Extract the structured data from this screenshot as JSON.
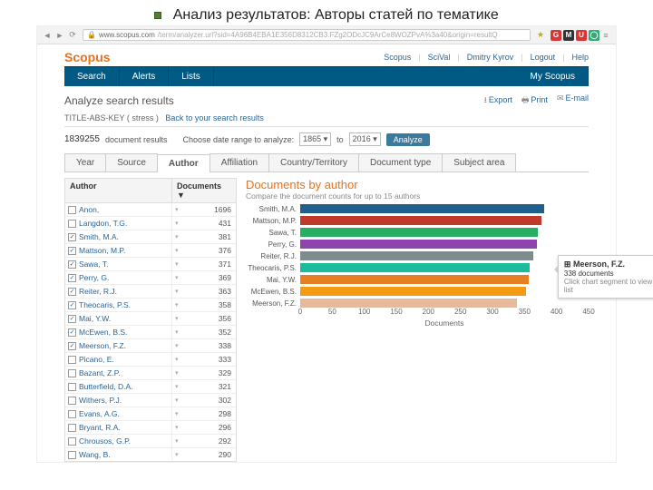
{
  "slide": {
    "title": "Анализ результатов: Авторы статей по тематике"
  },
  "browser": {
    "url_host": "www.scopus.com",
    "url_path": "/term/analyzer.url?sid=4A96B4EBA1E356D8312CB3.FZg2ODcJC9ArCe8WOZPvA%3a40&origin=resultQ"
  },
  "brand": "Scopus",
  "top_links": [
    "Scopus",
    "SciVal",
    "Dmitry Kyrov",
    "Logout",
    "Help"
  ],
  "nav": {
    "items": [
      "Search",
      "Alerts",
      "Lists"
    ],
    "right": "My Scopus"
  },
  "header": {
    "title": "Analyze search results",
    "actions": [
      {
        "icon": "⭳",
        "label": "Export"
      },
      {
        "icon": "🖶",
        "label": "Print"
      },
      {
        "icon": "✉",
        "label": "E-mail"
      }
    ]
  },
  "query": {
    "label": "TITLE-ABS-KEY ( stress )",
    "back": "Back to your search results"
  },
  "results": {
    "count": "1839255",
    "count_label": "document results",
    "range_label": "Choose date range to analyze:",
    "from": "1865",
    "to_label": "to",
    "to": "2016",
    "analyze_btn": "Analyze"
  },
  "tabs": [
    "Year",
    "Source",
    "Author",
    "Affiliation",
    "Country/Territory",
    "Document type",
    "Subject area"
  ],
  "active_tab": 2,
  "table": {
    "col_a": "Author",
    "col_b": "Documents ▼",
    "rows": [
      {
        "name": "Anon,",
        "n": 1696,
        "checked": false
      },
      {
        "name": "Langdon, T.G.",
        "n": 431,
        "checked": false
      },
      {
        "name": "Smith, M.A.",
        "n": 381,
        "checked": true
      },
      {
        "name": "Mattson, M.P.",
        "n": 376,
        "checked": true
      },
      {
        "name": "Sawa, T.",
        "n": 371,
        "checked": true
      },
      {
        "name": "Perry, G.",
        "n": 369,
        "checked": true
      },
      {
        "name": "Reiter, R.J.",
        "n": 363,
        "checked": true
      },
      {
        "name": "Theocaris, P.S.",
        "n": 358,
        "checked": true
      },
      {
        "name": "Mai, Y.W.",
        "n": 356,
        "checked": true
      },
      {
        "name": "McEwen, B.S.",
        "n": 352,
        "checked": true
      },
      {
        "name": "Meerson, F.Z.",
        "n": 338,
        "checked": true
      },
      {
        "name": "Picano, E.",
        "n": 333,
        "checked": false
      },
      {
        "name": "Bazant, Z.P.",
        "n": 329,
        "checked": false
      },
      {
        "name": "Butterfield, D.A.",
        "n": 321,
        "checked": false
      },
      {
        "name": "Withers, P.J.",
        "n": 302,
        "checked": false
      },
      {
        "name": "Evans, A.G.",
        "n": 298,
        "checked": false
      },
      {
        "name": "Bryant, R.A.",
        "n": 296,
        "checked": false
      },
      {
        "name": "Chrousos, G.P.",
        "n": 292,
        "checked": false
      },
      {
        "name": "Wang, B.",
        "n": 290,
        "checked": false
      }
    ]
  },
  "chart": {
    "title": "Documents by author",
    "subtitle": "Compare the document counts for up to 15 authors",
    "xlabel": "Documents",
    "tooltip": {
      "name": "Meerson, F.Z.",
      "line": "338 documents",
      "hint": "Click chart segment to view document list"
    }
  },
  "chart_data": {
    "type": "bar",
    "orientation": "horizontal",
    "xlabel": "Documents",
    "xlim": [
      0,
      450
    ],
    "xticks": [
      0,
      50,
      100,
      150,
      200,
      250,
      300,
      350,
      400,
      450
    ],
    "series": [
      {
        "name": "Smith, M.A.",
        "value": 381,
        "color": "#1f5f8b"
      },
      {
        "name": "Mattson, M.P.",
        "value": 376,
        "color": "#c0392b"
      },
      {
        "name": "Sawa, T.",
        "value": 371,
        "color": "#27ae60"
      },
      {
        "name": "Perry, G.",
        "value": 369,
        "color": "#8e44ad"
      },
      {
        "name": "Reiter, R.J.",
        "value": 363,
        "color": "#7f8c8d"
      },
      {
        "name": "Theocaris, P.S.",
        "value": 358,
        "color": "#1abc9c"
      },
      {
        "name": "Mai, Y.W.",
        "value": 356,
        "color": "#e67e22"
      },
      {
        "name": "McEwen, B.S.",
        "value": 352,
        "color": "#f39c12"
      },
      {
        "name": "Meerson, F.Z.",
        "value": 338,
        "color": "#e6b89c"
      }
    ]
  }
}
